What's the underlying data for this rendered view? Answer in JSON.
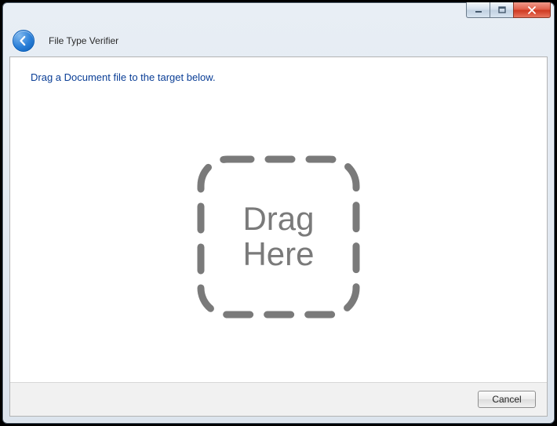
{
  "window": {
    "title": "File Type Verifier"
  },
  "main": {
    "instruction": "Drag a Document file to the target below.",
    "drop_label_line1": "Drag",
    "drop_label_line2": "Here"
  },
  "footer": {
    "cancel_label": "Cancel"
  }
}
